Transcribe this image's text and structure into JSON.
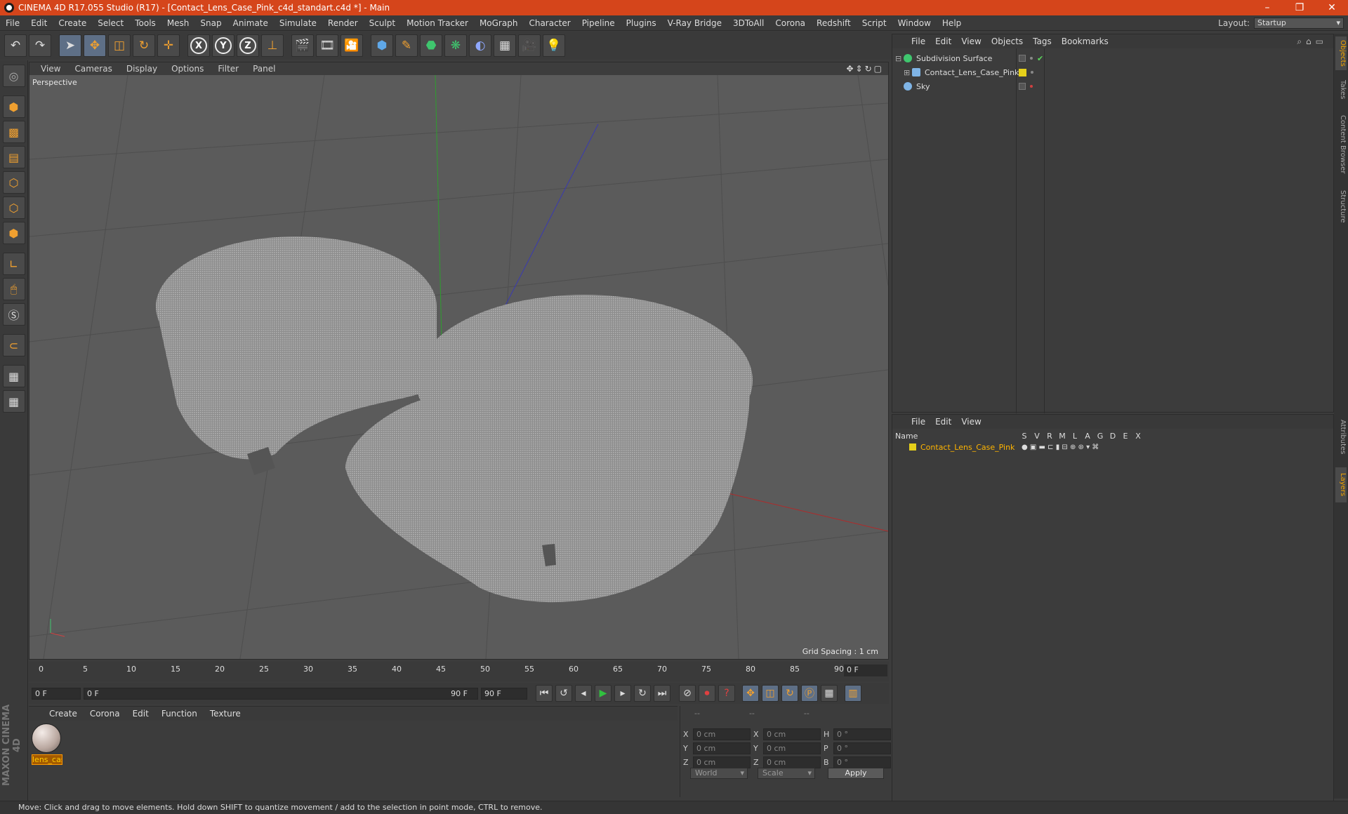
{
  "window": {
    "title": "CINEMA 4D R17.055 Studio (R17) - [Contact_Lens_Case_Pink_c4d_standart.c4d *] - Main",
    "controls": [
      "–",
      "❐",
      "✕"
    ]
  },
  "menubar": {
    "items": [
      "File",
      "Edit",
      "Create",
      "Select",
      "Tools",
      "Mesh",
      "Snap",
      "Animate",
      "Simulate",
      "Render",
      "Sculpt",
      "Motion Tracker",
      "MoGraph",
      "Character",
      "Pipeline",
      "Plugins",
      "V-Ray Bridge",
      "3DToAll",
      "Corona",
      "Redshift",
      "Script",
      "Window",
      "Help"
    ],
    "layout_label": "Layout:",
    "layout_value": "Startup"
  },
  "viewport": {
    "menu": [
      "View",
      "Cameras",
      "Display",
      "Options",
      "Filter",
      "Panel"
    ],
    "camera_label": "Perspective",
    "grid_spacing": "Grid Spacing : 1 cm"
  },
  "timeline": {
    "ticks": [
      "0",
      "5",
      "10",
      "15",
      "20",
      "25",
      "30",
      "35",
      "40",
      "45",
      "50",
      "55",
      "60",
      "65",
      "70",
      "75",
      "80",
      "85",
      "90"
    ],
    "current_frame": "0 F",
    "start_field": "0 F",
    "range_start": "0 F",
    "range_end": "90 F",
    "end_field": "90 F"
  },
  "material_manager": {
    "menu": [
      "Create",
      "Corona",
      "Edit",
      "Function",
      "Texture"
    ],
    "material_name": "lens_cas"
  },
  "coordinates": {
    "headers": [
      "--",
      "--",
      "--"
    ],
    "rows": [
      {
        "a1": "X",
        "v1": "0 cm",
        "a2": "X",
        "v2": "0 cm",
        "a3": "H",
        "v3": "0 °"
      },
      {
        "a1": "Y",
        "v1": "0 cm",
        "a2": "Y",
        "v2": "0 cm",
        "a3": "P",
        "v3": "0 °"
      },
      {
        "a1": "Z",
        "v1": "0 cm",
        "a2": "Z",
        "v2": "0 cm",
        "a3": "B",
        "v3": "0 °"
      }
    ],
    "space": "World",
    "mode": "Scale",
    "apply": "Apply"
  },
  "object_manager": {
    "menu": [
      "File",
      "Edit",
      "View",
      "Objects",
      "Tags",
      "Bookmarks"
    ],
    "objects": [
      {
        "name": "Subdivision Surface",
        "icon_color": "#3fc66e"
      },
      {
        "name": "Contact_Lens_Case_Pink",
        "icon_color": "#7fb4e6"
      },
      {
        "name": "Sky",
        "icon_color": "#7fb4e6"
      }
    ]
  },
  "layer_manager": {
    "menu": [
      "File",
      "Edit",
      "View"
    ],
    "name_header": "Name",
    "columns": [
      "S",
      "V",
      "R",
      "M",
      "L",
      "A",
      "G",
      "D",
      "E",
      "X"
    ],
    "layer_name": "Contact_Lens_Case_Pink"
  },
  "side_tabs": [
    "Objects",
    "Takes",
    "Content Browser",
    "Structure",
    "Attributes",
    "Layers"
  ],
  "status": "Move: Click and drag to move elements. Hold down SHIFT to quantize movement / add to the selection in point mode, CTRL to remove.",
  "brand": "MAXON CINEMA 4D",
  "colors": {
    "title_bar": "#d5451b",
    "accent": "#f2a400",
    "viewport_bg": "#5b5b5b"
  }
}
